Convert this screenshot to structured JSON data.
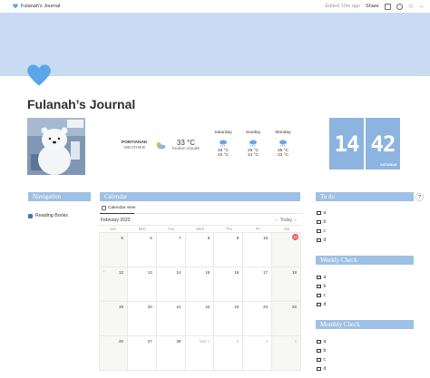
{
  "topbar": {
    "breadcrumb": "Fulanah's Journal",
    "edited": "Edited 10m ago",
    "share": "Share"
  },
  "page": {
    "title": "Fulanah’s Journal"
  },
  "weather": {
    "city": "PONTIANAK",
    "label": "WEATHER",
    "temp": "33 °C",
    "desc": "broken clouds",
    "forecast": [
      {
        "day": "Saturday",
        "hi": "33 °C",
        "lo": "24 °C"
      },
      {
        "day": "Sunday",
        "hi": "29 °C",
        "lo": "24 °C"
      },
      {
        "day": "Monday",
        "hi": "26 °C",
        "lo": "23 °C"
      }
    ]
  },
  "clock": {
    "hours": "14",
    "minutes": "42",
    "day": "SATURDAY"
  },
  "navigation": {
    "title": "Navigation",
    "items": [
      {
        "label": "Reading Books"
      }
    ]
  },
  "calendar": {
    "title": "Calendar",
    "view_tab": "Calendar view",
    "month": "February 2023",
    "today_btn": "Today",
    "weekdays": [
      "Sun",
      "Mon",
      "Tue",
      "Wed",
      "Thu",
      "Fri",
      "Sat"
    ],
    "weeks": [
      [
        "5",
        "6",
        "7",
        "8",
        "9",
        "10",
        "11"
      ],
      [
        "12",
        "13",
        "14",
        "15",
        "16",
        "17",
        "18"
      ],
      [
        "19",
        "20",
        "21",
        "22",
        "23",
        "24",
        "25"
      ],
      [
        "26",
        "27",
        "28",
        "Mar 1",
        "2",
        "3",
        "4"
      ]
    ],
    "today": "11"
  },
  "todo": {
    "title": "To do",
    "items": [
      "a",
      "b",
      "c",
      "d"
    ]
  },
  "weekly": {
    "title": "Weekly Check",
    "items": [
      "a",
      "b",
      "c",
      "d"
    ]
  },
  "monthly": {
    "title": "Monthly Check",
    "items": [
      "a",
      "b",
      "c",
      "d"
    ]
  },
  "colors": {
    "cover": "#c9dbf3",
    "header": "#9ec0e4",
    "clock": "#8db4e0",
    "heart": "#5aa6e8",
    "today": "#eb5757"
  }
}
